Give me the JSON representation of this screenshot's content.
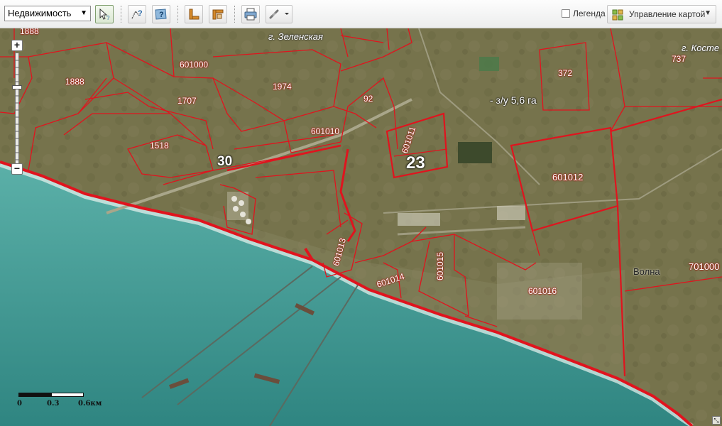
{
  "toolbar": {
    "layer_select": "Недвижимость",
    "legend_label": "Легенда",
    "map_control_label": "Управление картой",
    "tools": [
      "select-info-icon",
      "measure-info-icon",
      "object-info-icon",
      "ruler-icon",
      "area-icon",
      "print-icon",
      "link-icon"
    ]
  },
  "map": {
    "parcels": [
      {
        "id": "p1888a",
        "text": "1888"
      },
      {
        "id": "p1888b",
        "text": "1888"
      },
      {
        "id": "p601000",
        "text": "601000"
      },
      {
        "id": "p1974",
        "text": "1974"
      },
      {
        "id": "p1707",
        "text": "1707"
      },
      {
        "id": "p92",
        "text": "92"
      },
      {
        "id": "p372",
        "text": "372"
      },
      {
        "id": "p737",
        "text": "737"
      },
      {
        "id": "p601010",
        "text": "601010"
      },
      {
        "id": "p1518",
        "text": "1518"
      },
      {
        "id": "p601011",
        "text": "601011"
      },
      {
        "id": "p601012",
        "text": "601012"
      },
      {
        "id": "p601013",
        "text": "601013"
      },
      {
        "id": "p601015",
        "text": "601015"
      },
      {
        "id": "p601014",
        "text": "601014"
      },
      {
        "id": "p601016",
        "text": "601016"
      },
      {
        "id": "p701000",
        "text": "701000"
      }
    ],
    "big_labels": {
      "l30": "30",
      "l23": "23"
    },
    "places": {
      "zelenskaya": "г. Зеленская",
      "kost": "г. Косте",
      "volna": "Волна"
    },
    "area_label": "- з/у 5,6 га"
  },
  "scale": {
    "l0": "0",
    "l1": "0.3",
    "l2": "0.6км"
  },
  "colors": {
    "boundary": "#e0141e",
    "sea": "#3f9994",
    "land": "#77744d"
  }
}
